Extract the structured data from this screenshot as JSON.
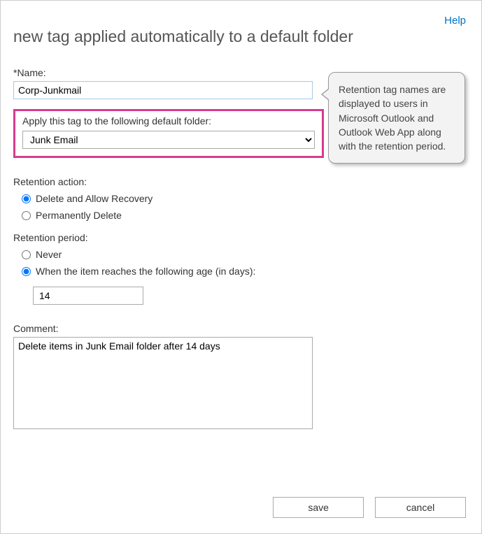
{
  "help": {
    "label": "Help"
  },
  "title": "new tag applied automatically to a default folder",
  "name": {
    "label": "*Name:",
    "value": "Corp-Junkmail"
  },
  "applyTo": {
    "label": "Apply this tag to the following default folder:",
    "selected": "Junk Email"
  },
  "retentionAction": {
    "label": "Retention action:",
    "options": {
      "deleteRecover": {
        "label": "Delete and Allow Recovery",
        "checked": true
      },
      "permDelete": {
        "label": "Permanently Delete",
        "checked": false
      }
    }
  },
  "retentionPeriod": {
    "label": "Retention period:",
    "options": {
      "never": {
        "label": "Never",
        "checked": false
      },
      "age": {
        "label": "When the item reaches the following age (in days):",
        "checked": true
      }
    },
    "ageValue": "14"
  },
  "comment": {
    "label": "Comment:",
    "value": "Delete items in Junk Email folder after 14 days"
  },
  "callout": {
    "text": "Retention tag names are displayed to users in Microsoft Outlook and Outlook Web App along with the retention period."
  },
  "buttons": {
    "save": "save",
    "cancel": "cancel"
  }
}
